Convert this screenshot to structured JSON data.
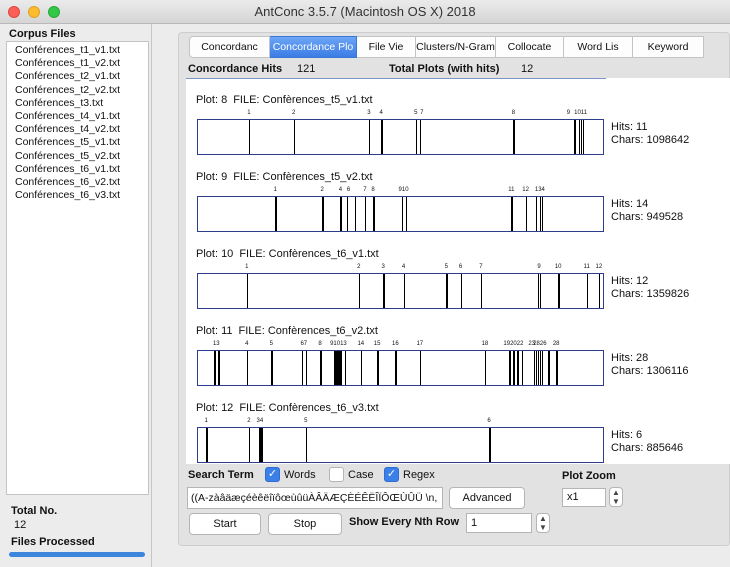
{
  "window": {
    "title": "AntConc 3.5.7 (Macintosh OS X) 2018"
  },
  "sidebar": {
    "title": "Corpus Files",
    "files": [
      "Conférences_t1_v1.txt",
      "Conférences_t1_v2.txt",
      "Conférences_t2_v1.txt",
      "Conférences_t2_v2.txt",
      "Conférences_t3.txt",
      "Conférences_t4_v1.txt",
      "Conférences_t4_v2.txt",
      "Conférences_t5_v1.txt",
      "Conférences_t5_v2.txt",
      "Conférences_t6_v1.txt",
      "Conférences_t6_v2.txt",
      "Conférences_t6_v3.txt"
    ],
    "total_label": "Total No.",
    "total_value": "12",
    "processed_label": "Files Processed",
    "progress": 1.0
  },
  "tabs": [
    {
      "label": "Concordanc",
      "active": false
    },
    {
      "label": "Concordance Plo",
      "active": true
    },
    {
      "label": "File Vie",
      "active": false
    },
    {
      "label": "Clusters/N-Gram",
      "active": false
    },
    {
      "label": "Collocate",
      "active": false
    },
    {
      "label": "Word Lis",
      "active": false
    },
    {
      "label": "Keyword",
      "active": false
    }
  ],
  "summary": {
    "hits_label": "Concordance Hits",
    "hits_value": "121",
    "plots_label": "Total Plots (with hits)",
    "plots_value": "12"
  },
  "plots": [
    {
      "plot_label": "Plot: 8",
      "file_label": "FILE: Confèrences_t5_v1.txt",
      "hits_text": "Hits: 11",
      "chars_text": "Chars: 1098642",
      "hit_positions": [
        0.125,
        0.235,
        0.42,
        0.45,
        0.535,
        0.545,
        0.775,
        0.925,
        0.935,
        0.94,
        0.945
      ],
      "labels": [
        {
          "t": "1",
          "p": 0.125
        },
        {
          "t": "2",
          "p": 0.235
        },
        {
          "t": "3",
          "p": 0.42
        },
        {
          "t": "4",
          "p": 0.45
        },
        {
          "t": "5",
          "p": 0.535
        },
        {
          "t": "7",
          "p": 0.55
        },
        {
          "t": "8",
          "p": 0.775
        },
        {
          "t": "9",
          "p": 0.91
        },
        {
          "t": "1011",
          "p": 0.94
        }
      ]
    },
    {
      "plot_label": "Plot: 9",
      "file_label": "FILE: Confèrences_t5_v2.txt",
      "hits_text": "Hits: 14",
      "chars_text": "Chars: 949528",
      "hit_positions": [
        0.19,
        0.305,
        0.35,
        0.365,
        0.385,
        0.41,
        0.43,
        0.5,
        0.51,
        0.77,
        0.805,
        0.83,
        0.84,
        0.845
      ],
      "labels": [
        {
          "t": "1",
          "p": 0.19
        },
        {
          "t": "2",
          "p": 0.305
        },
        {
          "t": "4",
          "p": 0.35
        },
        {
          "t": "6",
          "p": 0.37
        },
        {
          "t": "7",
          "p": 0.41
        },
        {
          "t": "8",
          "p": 0.43
        },
        {
          "t": "910",
          "p": 0.505
        },
        {
          "t": "11",
          "p": 0.77
        },
        {
          "t": "12",
          "p": 0.805
        },
        {
          "t": "134",
          "p": 0.84
        }
      ]
    },
    {
      "plot_label": "Plot: 10",
      "file_label": "FILE: Confèrences_t6_v1.txt",
      "hits_text": "Hits: 12",
      "chars_text": "Chars: 1359826",
      "hit_positions": [
        0.12,
        0.395,
        0.455,
        0.505,
        0.61,
        0.645,
        0.695,
        0.835,
        0.84,
        0.885,
        0.955,
        0.985
      ],
      "labels": [
        {
          "t": "1",
          "p": 0.12
        },
        {
          "t": "2",
          "p": 0.395
        },
        {
          "t": "3",
          "p": 0.455
        },
        {
          "t": "4",
          "p": 0.505
        },
        {
          "t": "5",
          "p": 0.61
        },
        {
          "t": "6",
          "p": 0.645
        },
        {
          "t": "7",
          "p": 0.695
        },
        {
          "t": "9",
          "p": 0.838
        },
        {
          "t": "10",
          "p": 0.885
        },
        {
          "t": "11",
          "p": 0.955
        },
        {
          "t": "12",
          "p": 0.985
        }
      ]
    },
    {
      "plot_label": "Plot: 11",
      "file_label": "FILE: Confèrences_t6_v2.txt",
      "hits_text": "Hits: 28",
      "chars_text": "Chars: 1306116",
      "hit_positions": [
        0.04,
        0.05,
        0.12,
        0.18,
        0.255,
        0.265,
        0.3,
        0.335,
        0.34,
        0.345,
        0.35,
        0.36,
        0.4,
        0.44,
        0.485,
        0.545,
        0.705,
        0.765,
        0.775,
        0.785,
        0.795,
        0.825,
        0.83,
        0.835,
        0.84,
        0.845,
        0.86,
        0.88
      ],
      "labels": [
        {
          "t": "13",
          "p": 0.045
        },
        {
          "t": "4",
          "p": 0.12
        },
        {
          "t": "5",
          "p": 0.18
        },
        {
          "t": "67",
          "p": 0.26
        },
        {
          "t": "8",
          "p": 0.3
        },
        {
          "t": "91013",
          "p": 0.345
        },
        {
          "t": "14",
          "p": 0.4
        },
        {
          "t": "15",
          "p": 0.44
        },
        {
          "t": "16",
          "p": 0.485
        },
        {
          "t": "17",
          "p": 0.545
        },
        {
          "t": "18",
          "p": 0.705
        },
        {
          "t": "192022",
          "p": 0.775
        },
        {
          "t": "23",
          "p": 0.82
        },
        {
          "t": "2826",
          "p": 0.84
        },
        {
          "t": "28",
          "p": 0.88
        }
      ]
    },
    {
      "plot_label": "Plot: 12",
      "file_label": "FILE: Confèrences_t6_v3.txt",
      "hits_text": "Hits: 6",
      "chars_text": "Chars: 885646",
      "hit_positions": [
        0.02,
        0.125,
        0.15,
        0.155,
        0.265,
        0.715
      ],
      "labels": [
        {
          "t": "1",
          "p": 0.02
        },
        {
          "t": "2",
          "p": 0.125
        },
        {
          "t": "34",
          "p": 0.152
        },
        {
          "t": "5",
          "p": 0.265
        },
        {
          "t": "6",
          "p": 0.715
        }
      ]
    }
  ],
  "search": {
    "term_label": "Search Term",
    "words_label": "Words",
    "words_checked": true,
    "case_label": "Case",
    "case_checked": false,
    "regex_label": "Regex",
    "regex_checked": true,
    "term_value": "((A-zàâäæçéèêëîïôœùûüÀÂÄÆÇÈÉÊËÎÏÔŒÙÛÜ \\n,",
    "advanced_label": "Advanced",
    "zoom_label": "Plot Zoom",
    "zoom_value": "x1",
    "start_label": "Start",
    "stop_label": "Stop",
    "nth_label": "Show Every Nth Row",
    "nth_value": "1"
  }
}
